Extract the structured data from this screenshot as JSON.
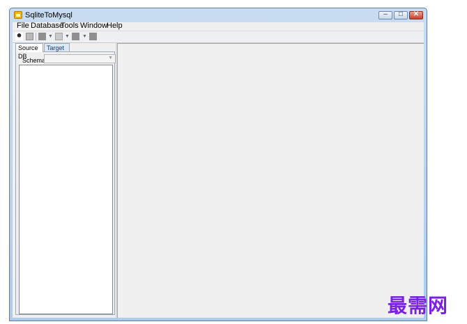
{
  "window": {
    "title": "SqliteToMysql",
    "controls": {
      "minimize": "–",
      "maximize": "□",
      "close": "✕"
    }
  },
  "menu": [
    "File",
    "Database",
    "Tools",
    "Window",
    "Help"
  ],
  "toolbar": {
    "icons": [
      "user-icon",
      "document-icon",
      "connect-icon",
      "dropdown-arrow-icon",
      "open-icon",
      "dropdown-arrow-icon",
      "run-icon",
      "dropdown-arrow-icon",
      "stop-icon"
    ]
  },
  "left_panel": {
    "tabs": [
      {
        "label": "Source DB",
        "active": true
      },
      {
        "label": "Target DB",
        "active": false
      }
    ],
    "schema_label": "Schema",
    "schema_value": ""
  },
  "watermark": "最需网",
  "colors": {
    "watermark": "#7b1fe0",
    "inactive_tab": "#dbe8f6"
  }
}
